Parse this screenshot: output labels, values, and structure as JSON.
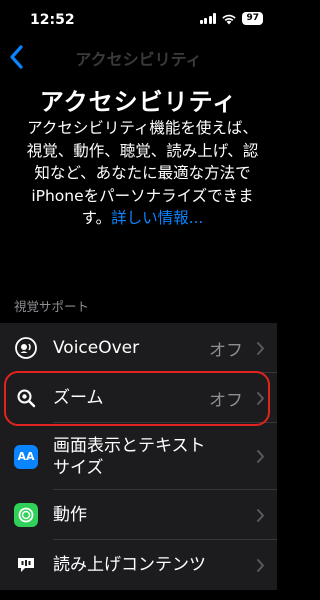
{
  "status_bar": {
    "time": "12:52",
    "battery": "97"
  },
  "nav": {
    "title": "アクセシビリティ"
  },
  "page_title": "アクセシビリティ",
  "intro": {
    "text": "アクセシビリティ機能を使えば、視覚、動作、聴覚、読み上げ、認知など、あなたに最適な方法でiPhoneをパーソナライズできます。",
    "link": "詳しい情報..."
  },
  "section": {
    "header": "視覚サポート"
  },
  "rows": [
    {
      "label": "VoiceOver",
      "value": "オフ",
      "icon": "voiceover-icon",
      "icon_color": "#1c1c1e"
    },
    {
      "label": "ズーム",
      "value": "オフ",
      "icon": "zoom-icon",
      "icon_color": "#1c1c1e"
    },
    {
      "label": "画面表示とテキストサイズ",
      "value": "",
      "icon": "text-size-icon",
      "icon_text": "AA",
      "icon_color": "#0a84ff"
    },
    {
      "label": "動作",
      "value": "",
      "icon": "motion-icon",
      "icon_color": "#30d158"
    },
    {
      "label": "読み上げコンテンツ",
      "value": "",
      "icon": "spoken-content-icon",
      "icon_color": "#1c1c1e"
    }
  ],
  "colors": {
    "accent": "#0a84ff",
    "highlight": "#e0231e",
    "cell_bg": "#1c1c1e"
  }
}
